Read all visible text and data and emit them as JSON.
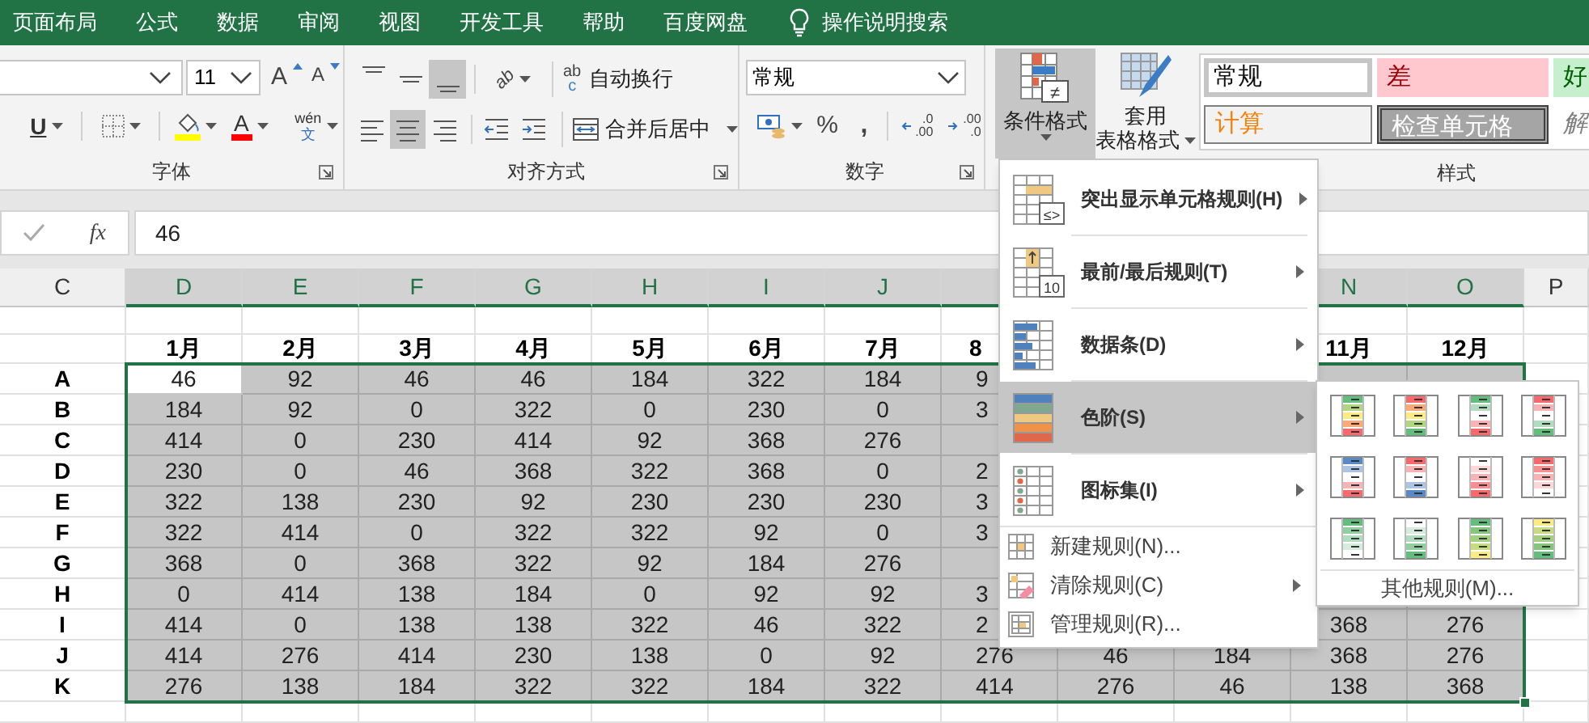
{
  "menu_tabs": [
    {
      "label": "页面布局"
    },
    {
      "label": "公式"
    },
    {
      "label": "数据"
    },
    {
      "label": "审阅"
    },
    {
      "label": "视图"
    },
    {
      "label": "开发工具"
    },
    {
      "label": "帮助"
    },
    {
      "label": "百度网盘"
    }
  ],
  "tell_me": {
    "placeholder": "操作说明搜索"
  },
  "ribbon": {
    "font": {
      "label": "字体",
      "size": "11",
      "grow": "A",
      "shrink": "A",
      "underline": "U",
      "color_letter": "A",
      "phonetic_top": "wén",
      "phonetic_bottom": "文"
    },
    "alignment": {
      "label": "对齐方式",
      "vertical": [
        {
          "selected": false
        },
        {
          "selected": false
        },
        {
          "selected": true
        }
      ],
      "horizontal": [
        {
          "selected": false
        },
        {
          "selected": true
        },
        {
          "selected": false
        }
      ],
      "orientation_letters": "ab",
      "wrap_top": "ab",
      "wrap_bottom": "c",
      "wrap_text": "自动换行",
      "merge": "合并后居中"
    },
    "number": {
      "label": "数字",
      "format": "常规",
      "percent": "%",
      "comma": ",",
      "increase_decimal": [
        ".0",
        ".00"
      ],
      "decrease_decimal": [
        ".00",
        ".0"
      ]
    },
    "styles": {
      "label": "样式",
      "conditional": {
        "label": "条件格式",
        "pressed": true,
        "icon_mark": "≠"
      },
      "table_format": {
        "lines": [
          "套用",
          "表格格式"
        ]
      },
      "cell_styles": [
        {
          "label": "常规",
          "kind": "normal",
          "selected": true
        },
        {
          "label": "差",
          "kind": "bad",
          "selected": false
        },
        {
          "label": "好",
          "kind": "good",
          "selected": false
        },
        {
          "label": "计算",
          "kind": "calculation",
          "selected": false
        },
        {
          "label": "检查单元格",
          "kind": "check",
          "selected": false
        },
        {
          "label": "解",
          "kind": "explanatory",
          "selected": false
        }
      ]
    }
  },
  "formula_bar": {
    "fx": "fx",
    "value": "46"
  },
  "sheet": {
    "row_label_column": {
      "label": "C",
      "selected": false
    },
    "columns": [
      {
        "kind": "full",
        "label": "D",
        "selected": true,
        "month": "1月"
      },
      {
        "kind": "full",
        "label": "E",
        "selected": true,
        "month": "2月"
      },
      {
        "kind": "full",
        "label": "F",
        "selected": true,
        "month": "3月"
      },
      {
        "kind": "full",
        "label": "G",
        "selected": true,
        "month": "4月"
      },
      {
        "kind": "full",
        "label": "H",
        "selected": true,
        "month": "5月"
      },
      {
        "kind": "full",
        "label": "I",
        "selected": true,
        "month": "6月"
      },
      {
        "kind": "full",
        "label": "J",
        "selected": true,
        "month": "7月"
      },
      {
        "kind": "cut",
        "month": "8"
      },
      {
        "kind": "covered"
      },
      {
        "kind": "covered"
      },
      {
        "kind": "full",
        "label": "N",
        "selected": true,
        "month": "11月"
      },
      {
        "kind": "full",
        "label": "O",
        "selected": true,
        "month": "12月"
      }
    ],
    "last_column": {
      "label": "P",
      "selected": false
    },
    "rows": [
      {
        "label": "A",
        "active_cell": true,
        "cells": [
          "46",
          "92",
          "46",
          "46",
          "184",
          "322",
          "184",
          "9",
          null,
          null,
          null,
          null
        ]
      },
      {
        "label": "B",
        "active_cell": false,
        "cells": [
          "184",
          "92",
          "0",
          "322",
          "0",
          "230",
          "0",
          "3",
          null,
          null,
          null,
          null
        ]
      },
      {
        "label": "C",
        "active_cell": false,
        "cells": [
          "414",
          "0",
          "230",
          "414",
          "92",
          "368",
          "276",
          null,
          null,
          null,
          null,
          null
        ]
      },
      {
        "label": "D",
        "active_cell": false,
        "cells": [
          "230",
          "0",
          "46",
          "368",
          "322",
          "368",
          "0",
          "2",
          null,
          null,
          null,
          null
        ]
      },
      {
        "label": "E",
        "active_cell": false,
        "cells": [
          "322",
          "138",
          "230",
          "92",
          "230",
          "230",
          "230",
          "3",
          null,
          null,
          null,
          null
        ]
      },
      {
        "label": "F",
        "active_cell": false,
        "cells": [
          "322",
          "414",
          "0",
          "322",
          "322",
          "92",
          "0",
          "3",
          null,
          null,
          null,
          null
        ]
      },
      {
        "label": "G",
        "active_cell": false,
        "cells": [
          "368",
          "0",
          "368",
          "322",
          "92",
          "184",
          "276",
          null,
          null,
          null,
          null,
          null
        ]
      },
      {
        "label": "H",
        "active_cell": false,
        "cells": [
          "0",
          "414",
          "138",
          "184",
          "0",
          "92",
          "92",
          "3",
          null,
          null,
          null,
          null
        ]
      },
      {
        "label": "I",
        "active_cell": false,
        "cells": [
          "414",
          "0",
          "138",
          "138",
          "322",
          "46",
          "322",
          "2",
          null,
          null,
          "368",
          "276"
        ]
      },
      {
        "label": "J",
        "active_cell": false,
        "cells": [
          "414",
          "276",
          "414",
          "230",
          "138",
          "0",
          "92",
          "276",
          "46",
          "184",
          "368",
          "276"
        ]
      },
      {
        "label": "K",
        "active_cell": false,
        "cells": [
          "276",
          "138",
          "184",
          "322",
          "322",
          "184",
          "322",
          "414",
          "276",
          "46",
          "138",
          "368"
        ]
      }
    ]
  },
  "context_menu": {
    "items": [
      {
        "kind": "large",
        "label": "突出显示单元格规则(H)",
        "submenu": true,
        "selected": false,
        "icon_text": "≤>"
      },
      {
        "kind": "large",
        "label": "最前/最后规则(T)",
        "submenu": true,
        "selected": false,
        "icon_text": "10"
      },
      {
        "kind": "large",
        "label": "数据条(D)",
        "submenu": true,
        "selected": false
      },
      {
        "kind": "large",
        "label": "色阶(S)",
        "submenu": true,
        "selected": true
      },
      {
        "kind": "large",
        "label": "图标集(I)",
        "submenu": true,
        "selected": false
      },
      {
        "kind": "small",
        "label": "新建规则(N)...",
        "submenu": false,
        "selected": false
      },
      {
        "kind": "small",
        "label": "清除规则(C)",
        "submenu": true,
        "selected": false
      },
      {
        "kind": "small",
        "label": "管理规则(R)...",
        "submenu": false,
        "selected": false
      }
    ]
  },
  "submenu": {
    "footer": "其他规则(M)..."
  }
}
